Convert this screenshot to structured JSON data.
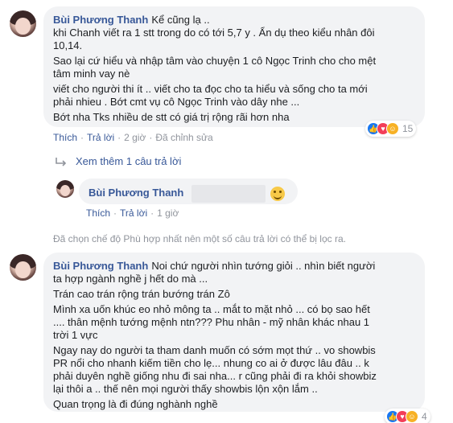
{
  "comment1": {
    "author": "Bùi Phương Thanh",
    "lines": [
      "Kể cũng lạ ..",
      "khi Chanh viết ra 1 stt trong do có tới 5,7 y . Ẩn dụ theo kiểu nhân đôi",
      "10,14.",
      "Sao lại cứ hiểu và nhập tâm vào chuyện 1 cô Ngọc Trinh cho cho mệt",
      "tâm minh vay nè",
      "viết cho người thi ít .. viết cho ta đọc cho ta hiểu và sống cho ta mới",
      "phải nhieu . Bớt cmt vụ cô Ngọc Trinh vào dây nhe ...",
      "Bớt nha Tks nhiều de stt có giá trị rộng rãi hơn nha"
    ],
    "actions": {
      "like": "Thích",
      "reply": "Trả lời",
      "time": "2 giờ",
      "edited": "Đã chỉnh sửa"
    },
    "reactions": {
      "icons": [
        "like-icon",
        "love-icon",
        "haha-icon"
      ],
      "count": "15"
    }
  },
  "more_replies": {
    "label": "Xem thêm 1 câu trả lời"
  },
  "reply1": {
    "author": "Bùi Phương Thanh",
    "actions": {
      "like": "Thích",
      "reply": "Trả lời",
      "time": "1 giờ"
    }
  },
  "notice": "Đã chọn chế độ Phù hợp nhất nên một số câu trả lời có thể bị lọc ra.",
  "comment2": {
    "author": "Bùi Phương Thanh",
    "lines": [
      "Noi chứ người nhìn tướng giỏi .. nhìn biết người",
      "ta hợp ngành nghề j hết do mà ...",
      "Trán cao trán rộng trán bướng trán Zô",
      "Mình xa uốn khúc eo nhỏ mông ta .. mắt to mặt nhỏ ... có bọ sao hết",
      ".... thân mệnh tướng mệnh ntn??? Phu nhân - mỹ nhân khác nhau 1",
      "trời 1 vực",
      "Ngay nay do người ta tham danh muốn có sớm mọt thứ .. vo showbis",
      "PR nổi cho nhanh kiếm tiền cho lẹ... nhung co ai ở được lâu đâu .. k",
      "phải duyên nghề giống nhu đi sai nha... r cũng phải đi ra khỏi showbiz",
      "lại thôi a .. thế nên mọi người thấy showbis lộn xộn lắm ..",
      "Quan trọng là đi đúng nghành nghề"
    ],
    "reactions": {
      "icons": [
        "like-icon",
        "love-icon",
        "haha-icon"
      ],
      "count": "4"
    }
  }
}
